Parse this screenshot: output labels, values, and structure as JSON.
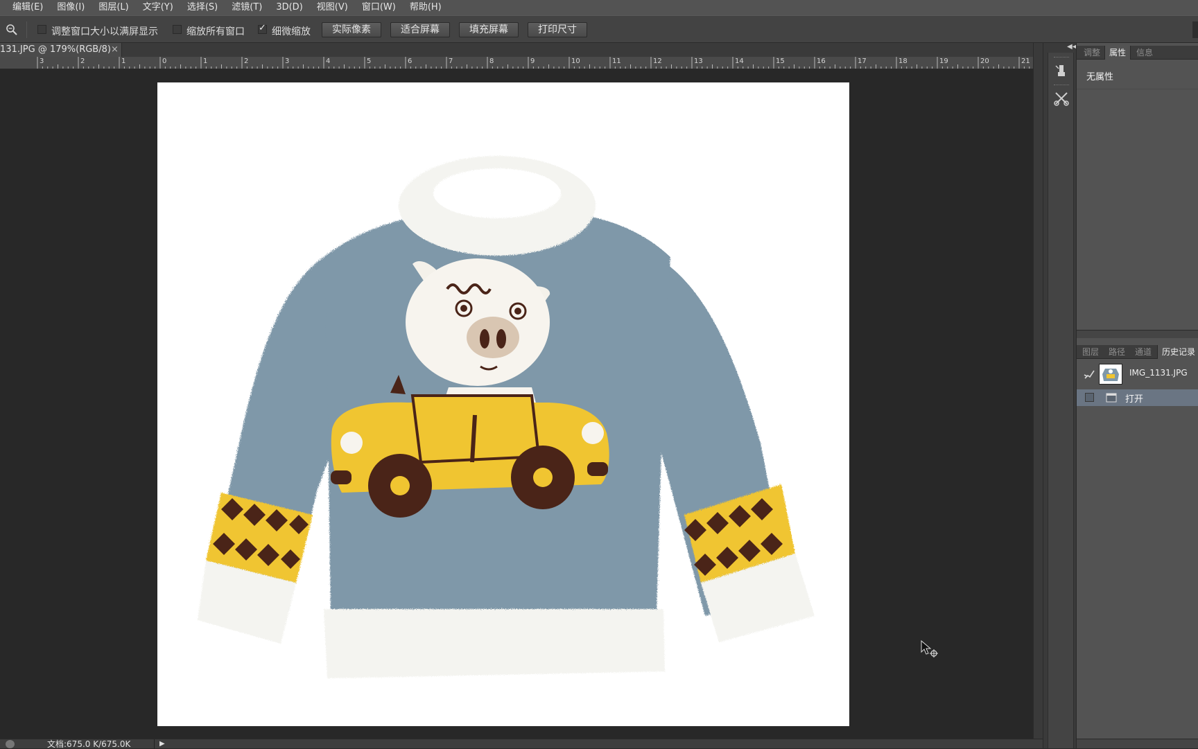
{
  "menu": [
    "编辑(E)",
    "图像(I)",
    "图层(L)",
    "文字(Y)",
    "选择(S)",
    "滤镜(T)",
    "3D(D)",
    "视图(V)",
    "窗口(W)",
    "帮助(H)"
  ],
  "options": {
    "resize_windows_label": "调整窗口大小以满屏显示",
    "resize_windows_checked": false,
    "zoom_all_label": "缩放所有窗口",
    "zoom_all_checked": false,
    "scrubby_zoom_label": "细微缩放",
    "scrubby_zoom_checked": true,
    "actual_pixels": "实际像素",
    "fit_screen": "适合屏幕",
    "fill_screen": "填充屏幕",
    "print_size": "打印尺寸"
  },
  "document": {
    "tab_title": "131.JPG @ 179%(RGB/8)",
    "close_glyph": "×"
  },
  "ruler": {
    "labels": [
      "3",
      "2",
      "1",
      "0",
      "1",
      "2",
      "3",
      "4",
      "5",
      "6",
      "7",
      "8",
      "9",
      "10",
      "11",
      "12",
      "13",
      "14",
      "15",
      "16",
      "17",
      "18",
      "19",
      "20",
      "21"
    ]
  },
  "status": {
    "doc_size": "文档:675.0 K/675.0K"
  },
  "properties_panel": {
    "tabs": [
      "调整",
      "属性",
      "信息"
    ],
    "active_tab": "属性",
    "content": "无属性"
  },
  "history_panel": {
    "tabs": [
      "图层",
      "路径",
      "通道",
      "历史记录"
    ],
    "active_tab": "历史记录",
    "snapshot_name": "IMG_1131.JPG",
    "states": [
      "打开"
    ]
  },
  "image": {
    "sweater_color": "#7f98a9",
    "trim_color": "#f4f4f0",
    "car_color": "#f0c531",
    "dark_color": "#4a2418"
  }
}
